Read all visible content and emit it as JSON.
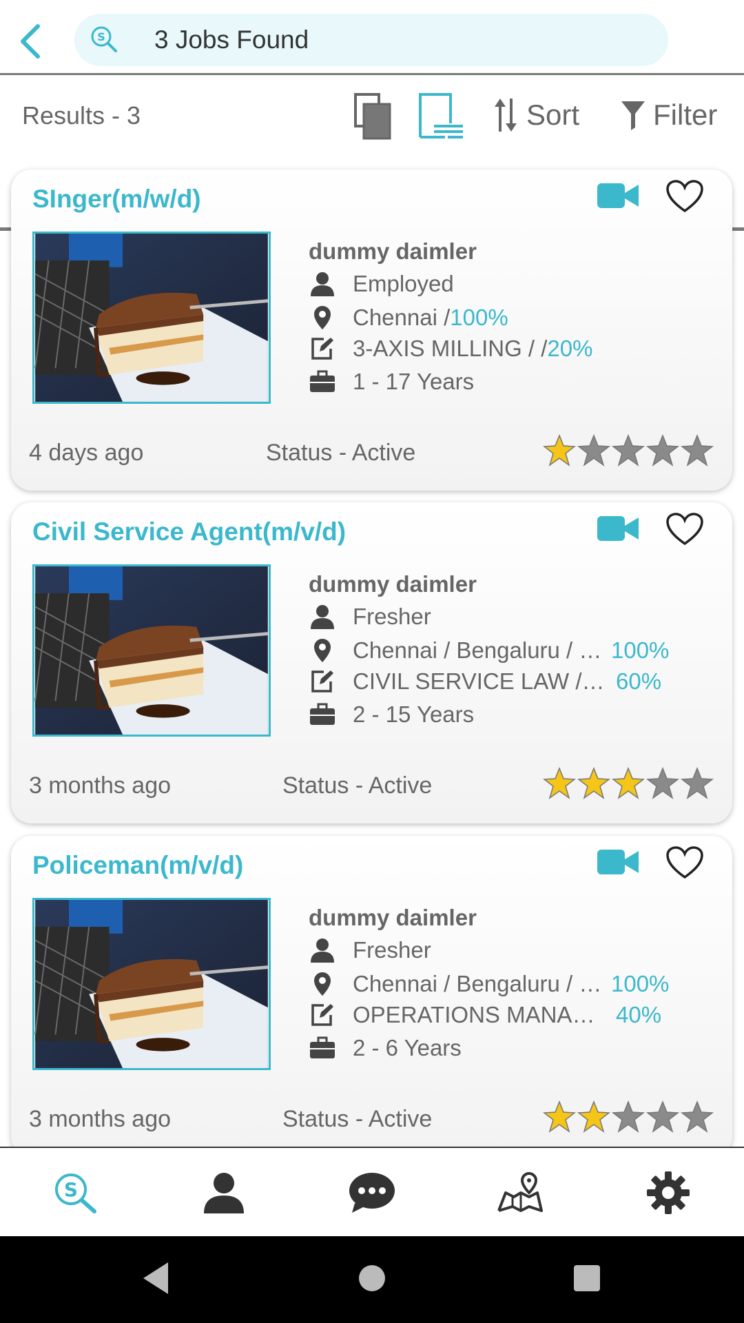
{
  "header": {
    "search_text": "3 Jobs Found"
  },
  "toolbar": {
    "results": "Results - 3",
    "sort_label": "Sort",
    "filter_label": "Filter"
  },
  "colors": {
    "accent": "#3bb8cc",
    "star_filled": "#f5c518",
    "star_empty": "#8a8a8a",
    "text": "#666666"
  },
  "jobs": [
    {
      "title": "SInger(m/w/d)",
      "company": "dummy daimler",
      "employment": "Employed",
      "location": "Chennai / ",
      "location_pct": "100%",
      "skill": "3-AXIS MILLING / / ",
      "skill_pct": "20%",
      "experience": "1 - 17  Years",
      "posted": "4 days ago",
      "status": "Status - Active",
      "rating": 1
    },
    {
      "title": "Civil Service Agent(m/v/d)",
      "company": "dummy daimler",
      "employment": "Fresher",
      "location": "Chennai / Bengaluru / Mumbai",
      "location_pct": "100%",
      "skill": "CIVIL SERVICE LAW / ADMIN",
      "skill_pct": "60%",
      "experience": "2 - 15  Years",
      "posted": "3 months ago",
      "status": "Status - Active",
      "rating": 3
    },
    {
      "title": "Policeman(m/v/d)",
      "company": "dummy daimler",
      "employment": "Fresher",
      "location": "Chennai / Bengaluru / Mumbai",
      "location_pct": "100%",
      "skill": "OPERATIONS MANAGEMENT",
      "skill_pct": "40%",
      "experience": "2 - 6  Years",
      "posted": "3 months ago",
      "status": "Status - Active",
      "rating": 2
    }
  ],
  "icons": {
    "back": "chevron-left-icon",
    "search": "search-icon",
    "grid_view": "cards-view-icon",
    "list_view": "list-view-icon",
    "sort": "sort-icon",
    "filter": "filter-icon",
    "video": "video-icon",
    "favorite": "heart-icon",
    "nav": [
      "search-icon",
      "profile-icon",
      "chat-icon",
      "map-icon",
      "settings-icon"
    ]
  }
}
